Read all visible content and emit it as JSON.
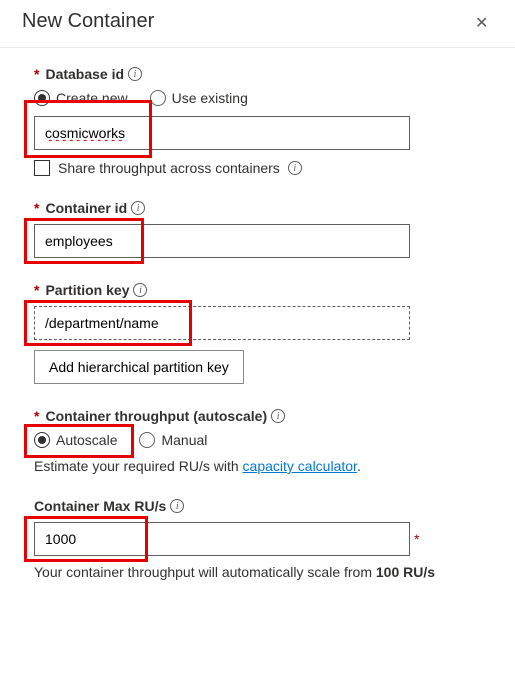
{
  "title": "New Container",
  "db": {
    "label": "Database id",
    "create": "Create new",
    "use": "Use existing",
    "value": "cosmicworks",
    "share": "Share throughput across containers"
  },
  "container": {
    "label": "Container id",
    "value": "employees"
  },
  "partition": {
    "label": "Partition key",
    "value": "/department/name",
    "addBtn": "Add hierarchical partition key"
  },
  "throughput": {
    "label": "Container throughput (autoscale)",
    "auto": "Autoscale",
    "manual": "Manual",
    "help1": "Estimate your required RU/s with ",
    "helpLink": "capacity calculator",
    "maxLabel": "Container Max RU/s",
    "maxValue": "1000",
    "note1": "Your container throughput will automatically scale from ",
    "note2": "100 RU/s"
  }
}
